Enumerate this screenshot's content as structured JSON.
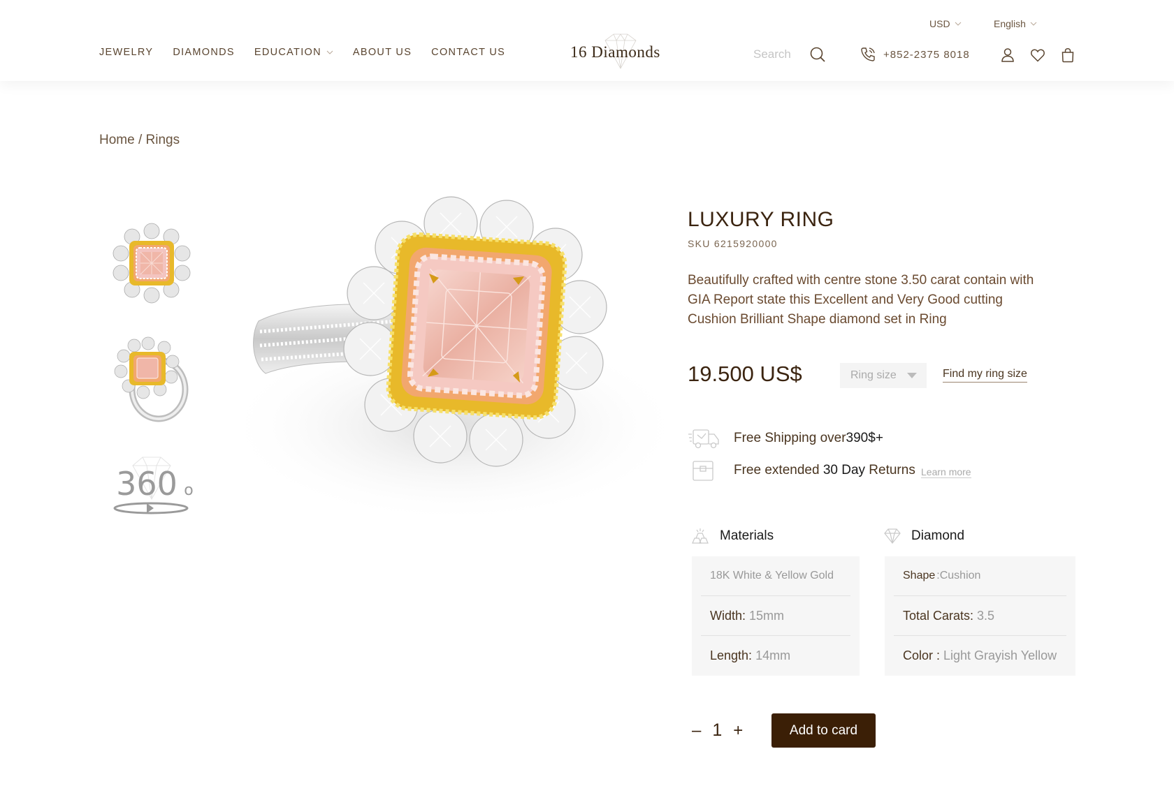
{
  "header": {
    "nav": [
      {
        "label": "JEWELRY"
      },
      {
        "label": "DIAMONDS"
      },
      {
        "label": "EDUCATION"
      },
      {
        "label": "ABOUT US"
      },
      {
        "label": "CONTACT US"
      }
    ],
    "logo_text": "16 Diamonds",
    "currency": "USD",
    "language": "English",
    "search_placeholder": "Search",
    "phone": "+852-2375 8018"
  },
  "breadcrumb": {
    "home": "Home",
    "separator": "/",
    "current": "Rings"
  },
  "gallery": {
    "rotate_label": "360",
    "rotate_degree": "o"
  },
  "product": {
    "title": "LUXURY RING",
    "sku": "SKU 6215920000",
    "description": "Beautifully crafted with centre stone 3.50 carat contain with GIA Report state this Excellent and Very Good cutting Cushion Brilliant Shape diamond set in Ring",
    "price": "19.500 US$",
    "ring_size_placeholder": "Ring size",
    "find_ring_size": "Find my ring size",
    "shipping": {
      "prefix": "Free Shipping over ",
      "amount": "390$+"
    },
    "returns": {
      "prefix": "Free extended ",
      "days": "30 Day",
      "suffix": " Returns"
    },
    "learn_more": "Learn more"
  },
  "materials": {
    "heading": "Materials",
    "metal": "18K White & Yellow Gold",
    "width_label": "Width:",
    "width_value": "15mm",
    "length_label": "Length:",
    "length_value": "14mm"
  },
  "diamond": {
    "heading": "Diamond",
    "shape_label": "Shape",
    "shape_value": ":Cushion",
    "carats_label": "Total Carats:",
    "carats_value": "3.5",
    "color_label": "Color :",
    "color_value": "Light Grayish Yellow"
  },
  "cart": {
    "minus": "–",
    "quantity": "1",
    "plus": "+",
    "add_label": "Add to card"
  },
  "colors": {
    "brand_dark": "#3b1f06",
    "text_brown": "#4a3520",
    "gold": "#e8b92a",
    "pink": "#f0b6a8"
  }
}
